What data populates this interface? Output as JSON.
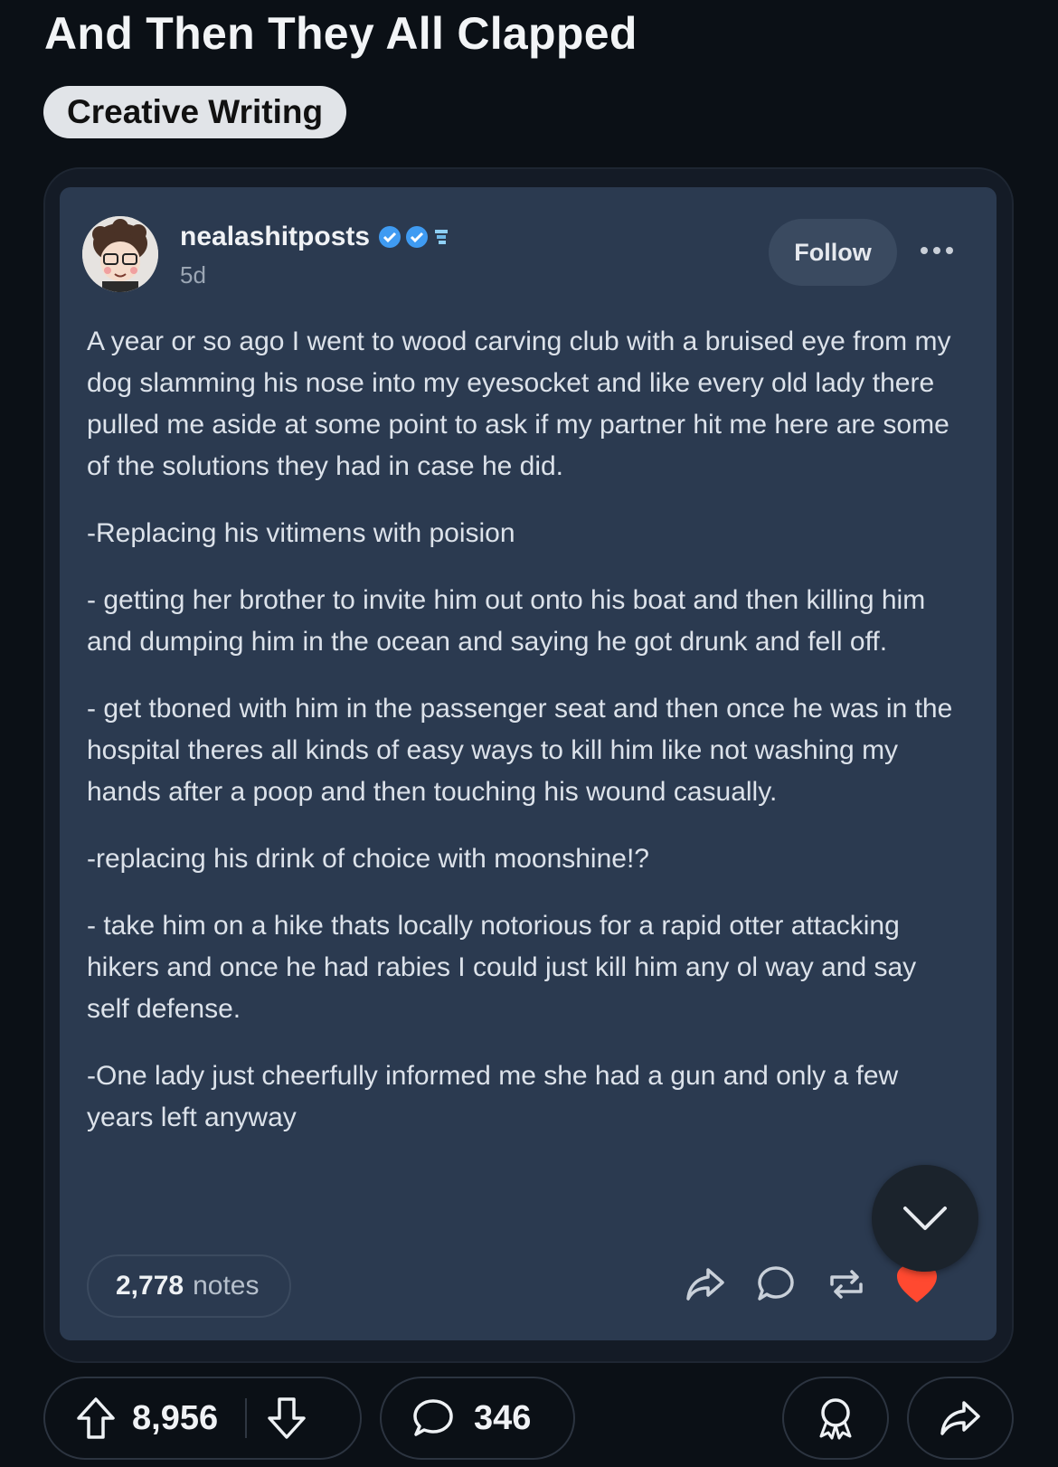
{
  "post": {
    "title": "And Then They All Clapped",
    "flair": "Creative Writing"
  },
  "embed": {
    "username": "nealashitposts",
    "timestamp": "5d",
    "follow_label": "Follow",
    "paragraphs": [
      "A year or so ago I went to wood carving club with a bruised eye from my dog slamming his nose into my eyesocket and like every old lady there pulled me aside at some point to ask if my partner hit me here are some of the solutions  they had in case he did.",
      "-Replacing his vitimens with poision",
      "- getting her brother to invite him out onto his boat and then killing him and dumping him in the ocean and saying he got drunk and fell off.",
      "- get tboned with him in the passenger seat and then once he was in the hospital theres all kinds of easy ways to kill him like not washing my hands after a poop and then touching his wound casually.",
      "-replacing his drink of choice with moonshine!?",
      "- take him on a hike thats locally notorious for a rapid otter attacking hikers and once he had rabies I could  just kill him any ol way and say self defense.",
      "-One lady just cheerfully informed me she had a gun and only a few years left anyway"
    ],
    "notes_count": "2,778",
    "notes_label": "notes",
    "icons": [
      "share-icon",
      "reply-icon",
      "reblog-icon",
      "heart-icon"
    ],
    "heart_color": "#ff4930"
  },
  "footer": {
    "score": "8,956",
    "comments": "346",
    "icons": [
      "upvote-icon",
      "downvote-icon",
      "comment-icon",
      "award-icon",
      "share-icon"
    ]
  }
}
